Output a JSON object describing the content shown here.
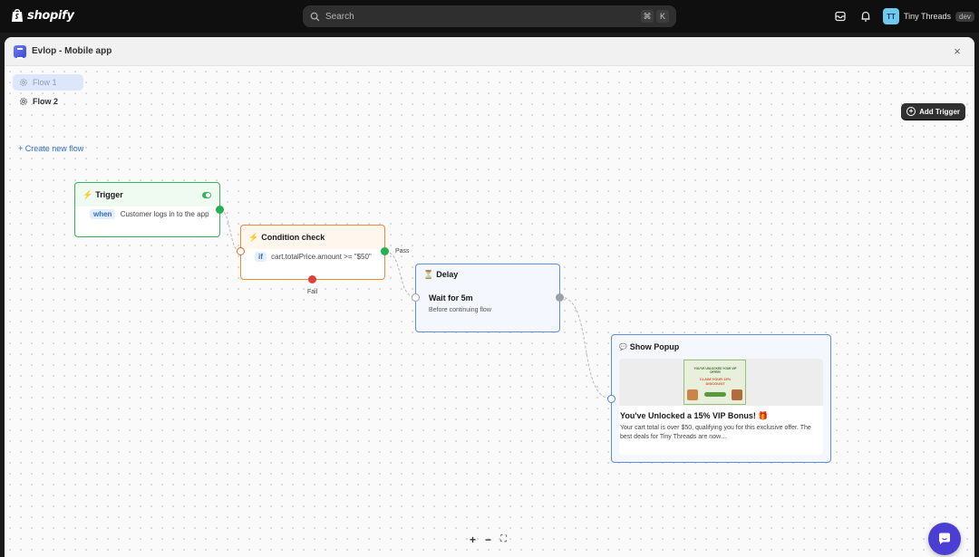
{
  "topbar": {
    "brand": "shopify",
    "search_placeholder": "Search",
    "search_shortcut": [
      "⌘",
      "K"
    ],
    "store_initials": "TT",
    "store_name": "Tiny Threads",
    "store_badge": "dev"
  },
  "modal": {
    "title": "Evlop - Mobile app",
    "close_symbol": "×"
  },
  "sidebar": {
    "flows": [
      {
        "label": "Flow 1",
        "active": true
      },
      {
        "label": "Flow 2",
        "active": false
      }
    ],
    "create_label": "+ Create new flow"
  },
  "toolbar": {
    "add_trigger_label": "Add Trigger"
  },
  "nodes": {
    "trigger": {
      "title": "Trigger",
      "keyword": "when",
      "condition": "Customer logs in to the app",
      "enabled": true
    },
    "condition": {
      "title": "Condition check",
      "keyword": "if",
      "expression": "cart.totalPrice.amount >= \"$50\"",
      "pass_label": "Pass",
      "fail_label": "Fail"
    },
    "delay": {
      "title": "Delay",
      "heading": "Wait for 5m",
      "subtext": "Before continuing flow"
    },
    "popup": {
      "title": "Show Popup",
      "image_line1": "YOU'VE UNLOCKED YOUR VIP OFFER!",
      "image_line2": "CLAIM YOUR 15% DISCOUNT",
      "heading": "You've Unlocked a 15% VIP Bonus! 🎁",
      "description": "Your cart total is over $50, qualifying you for this exclusive offer. The best deals for Tiny Threads are now…"
    }
  },
  "zoom": {
    "in": "+",
    "out": "−",
    "fit": "⛶"
  },
  "colors": {
    "trigger_border": "#34b45a",
    "condition_border": "#f08a3a",
    "action_border": "#5b8de6",
    "chat_button": "#4a3ed4"
  }
}
